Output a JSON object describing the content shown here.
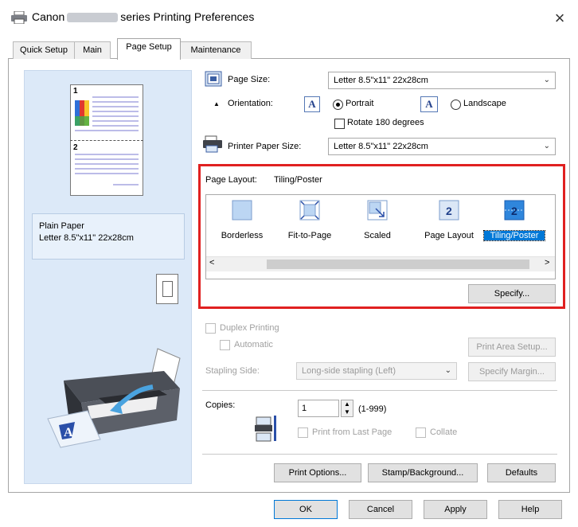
{
  "window": {
    "title_prefix": "Canon",
    "title_suffix": "series Printing Preferences",
    "close_glyph": "×"
  },
  "tabs": [
    {
      "label": "Quick Setup"
    },
    {
      "label": "Main"
    },
    {
      "label": "Page Setup"
    },
    {
      "label": "Maintenance"
    }
  ],
  "preview": {
    "page1_number": "1",
    "page2_number": "2",
    "media_type": "Plain Paper",
    "paper_size": "Letter 8.5\"x11\" 22x28cm"
  },
  "page_size": {
    "label": "Page Size:",
    "value": "Letter 8.5\"x11\" 22x28cm"
  },
  "orientation": {
    "label": "Orientation:",
    "portrait_label": "Portrait",
    "landscape_label": "Landscape",
    "rotate_label": "Rotate 180 degrees",
    "portrait_checked": true,
    "rotate_checked": false,
    "icon_glyph": "A"
  },
  "printer_paper_size": {
    "label": "Printer Paper Size:",
    "value": "Letter 8.5\"x11\" 22x28cm"
  },
  "page_layout": {
    "label": "Page Layout:",
    "current": "Tiling/Poster",
    "items": [
      {
        "label": "Borderless"
      },
      {
        "label": "Fit-to-Page"
      },
      {
        "label": "Scaled"
      },
      {
        "label": "Page Layout",
        "icon_text": "2"
      },
      {
        "label": "Tiling/Poster",
        "icon_text": "2",
        "selected": true
      }
    ],
    "scroll_left": "<",
    "scroll_right": ">",
    "specify_button": "Specify..."
  },
  "duplex": {
    "label": "Duplex Printing",
    "automatic_label": "Automatic",
    "print_area_button": "Print Area Setup...",
    "stapling_label": "Stapling Side:",
    "stapling_value": "Long-side stapling (Left)",
    "specify_margin_button": "Specify Margin..."
  },
  "copies": {
    "label": "Copies:",
    "value": "1",
    "range": "(1-999)",
    "print_from_last_label": "Print from Last Page",
    "collate_label": "Collate"
  },
  "bottom_buttons": {
    "print_options": "Print Options...",
    "stamp_background": "Stamp/Background...",
    "defaults": "Defaults"
  },
  "dialog_buttons": {
    "ok": "OK",
    "cancel": "Cancel",
    "apply": "Apply",
    "help": "Help"
  },
  "colors": {
    "preview_bg": "#dce9f8",
    "highlight_border": "#e02020",
    "selection": "#0078d7"
  }
}
